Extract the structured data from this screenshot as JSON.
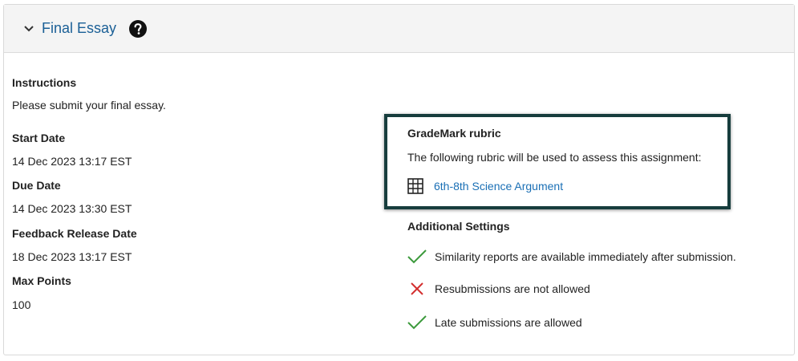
{
  "header": {
    "title": "Final Essay",
    "icons": {
      "toggle": "chevron-down-icon",
      "help": "help-circle-icon"
    }
  },
  "details": {
    "instructions_label": "Instructions",
    "instructions_value": "Please submit your final essay.",
    "start_date_label": "Start Date",
    "start_date_value": "14 Dec 2023 13:17 EST",
    "due_date_label": "Due Date",
    "due_date_value": "14 Dec 2023 13:30 EST",
    "feedback_label": "Feedback Release Date",
    "feedback_value": "18 Dec 2023 13:17 EST",
    "max_points_label": "Max Points",
    "max_points_value": "100"
  },
  "rubric": {
    "title": "GradeMark rubric",
    "description": "The following rubric will be used to assess this assignment:",
    "link_label": "6th-8th Science Argument",
    "icon": "table-grid-icon"
  },
  "settings": {
    "title": "Additional Settings",
    "items": [
      {
        "text": "Similarity reports are available immediately after submission.",
        "status": "allowed",
        "icon": "check-icon"
      },
      {
        "text": "Resubmissions are not allowed",
        "status": "not-allowed",
        "icon": "cross-icon"
      },
      {
        "text": "Late submissions are allowed",
        "status": "allowed",
        "icon": "check-icon"
      }
    ]
  },
  "colors": {
    "link": "#1a6fb5",
    "title": "#1a5f96",
    "check": "#3c9a3c",
    "cross": "#d32f2f",
    "highlight_border": "#173d3d"
  }
}
